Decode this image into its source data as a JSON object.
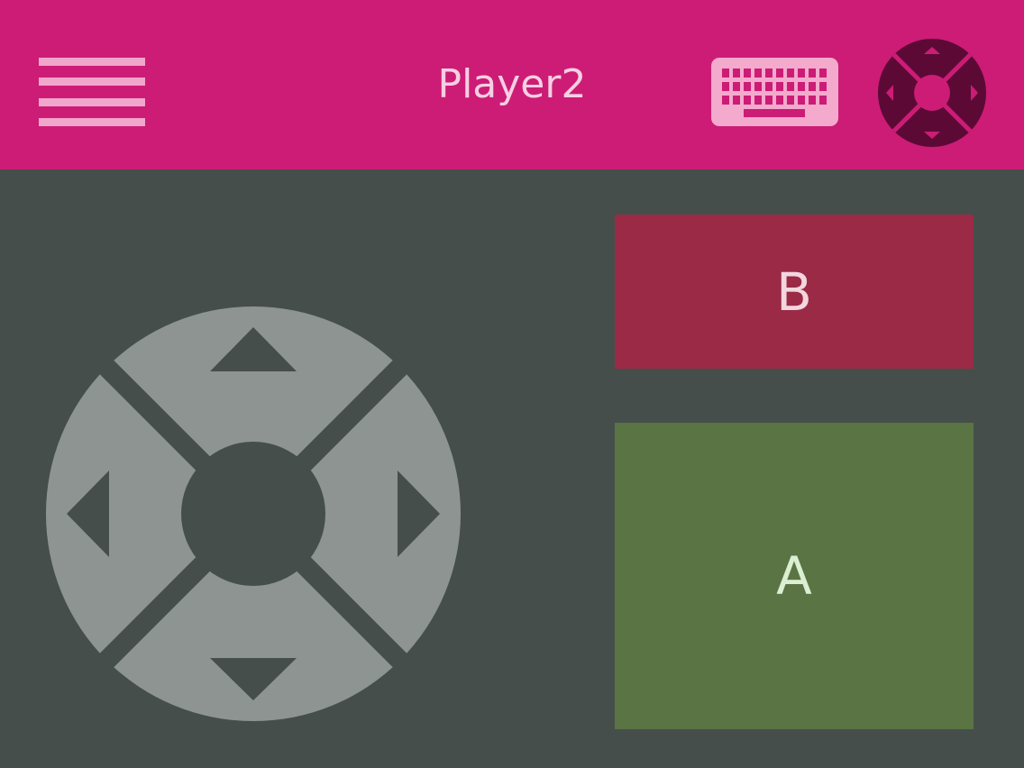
{
  "header": {
    "title": "Player2",
    "menu_icon": "hamburger-menu-icon",
    "keyboard_icon": "keyboard-icon",
    "gamepad_icon": "dpad-gamepad-icon",
    "background_color": "#cc1c76"
  },
  "controller": {
    "dpad": {
      "up_icon": "arrow-up-icon",
      "down_icon": "arrow-down-icon",
      "left_icon": "arrow-left-icon",
      "right_icon": "arrow-right-icon"
    },
    "button_b": {
      "label": "B",
      "color": "#9a2a46"
    },
    "button_a": {
      "label": "A",
      "color": "#5a7444"
    },
    "background_color": "#454e4a"
  }
}
